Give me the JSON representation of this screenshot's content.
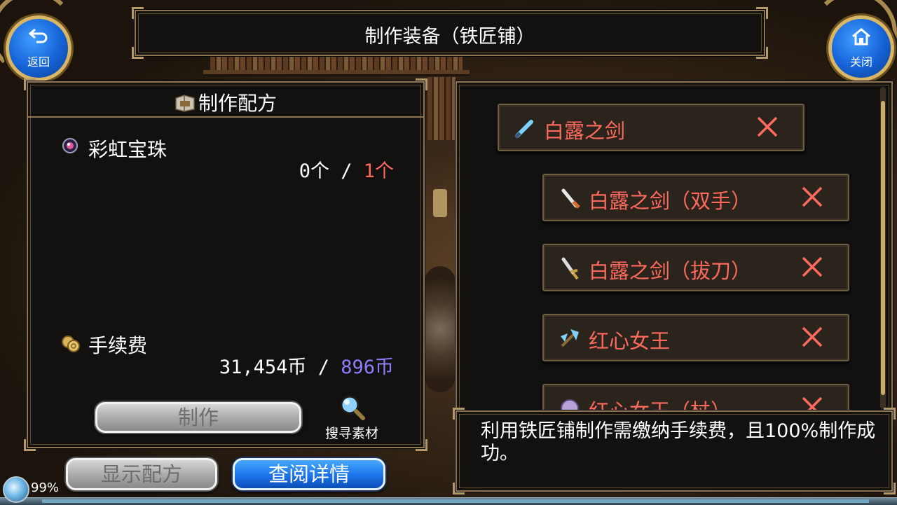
{
  "window_title": "制作装备（铁匠铺）",
  "nav": {
    "back_label": "返回",
    "close_label": "关闭"
  },
  "recipe": {
    "title": "制作配方",
    "material_name": "彩虹宝珠",
    "material_have": "0个",
    "material_sep": " / ",
    "material_need": "1个",
    "fee_label": "手续费",
    "fee_have": "31,454币",
    "fee_sep": " / ",
    "fee_need": "896币",
    "craft_button": "制作",
    "search_label": "搜寻素材"
  },
  "bottom_buttons": {
    "show_recipe": "显示配方",
    "view_details": "查阅详情"
  },
  "equipment_list": [
    {
      "name": "白露之剑",
      "icon": "sword-icon"
    },
    {
      "name": "白露之剑（双手）",
      "icon": "dagger-icon"
    },
    {
      "name": "白露之剑（拔刀）",
      "icon": "katana-icon"
    },
    {
      "name": "红心女王",
      "icon": "axe-icon"
    },
    {
      "name": "红心女王（杖）",
      "icon": "staff-icon"
    }
  ],
  "info_text": "利用铁匠铺制作需缴纳手续费，且100%制作成功。",
  "status": {
    "battery": "99%"
  },
  "colors": {
    "need_insufficient": "#ff6a5e",
    "fee_need": "#8f7cff",
    "item_name": "#ff6a5e",
    "frame_gold": "#8c7550",
    "button_blue": "#1b73e8"
  }
}
